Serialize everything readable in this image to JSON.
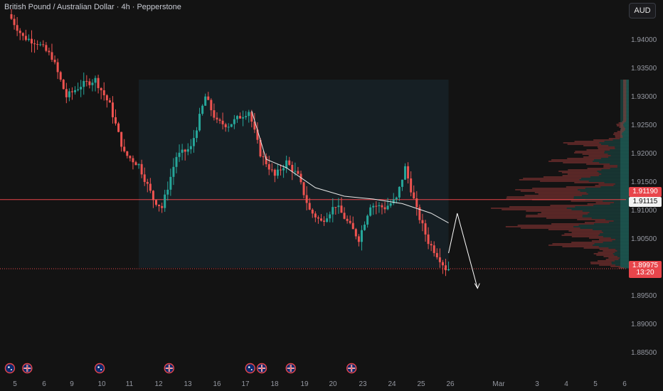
{
  "header": {
    "title": "British Pound / Australian Dollar · 4h · Pepperstone",
    "currency_button": "AUD"
  },
  "colors": {
    "background": "#131313",
    "up": "#26a69a",
    "down": "#ef5350",
    "ma": "#e8e8e8",
    "range_box": "#1a2a33",
    "current_line": "#e8454b",
    "axis_text": "#9598a1"
  },
  "price_tags": {
    "high_line": "1.91190",
    "vwap": "1.91115",
    "last_price": "1.89975",
    "countdown": "13:20"
  },
  "chart_data": {
    "type": "candlestick",
    "title": "British Pound / Australian Dollar · 4h · Pepperstone",
    "ylim": [
      1.882,
      1.947
    ],
    "y_ticks": [
      "1.94000",
      "1.93500",
      "1.93000",
      "1.92500",
      "1.92000",
      "1.91500",
      "1.91000",
      "1.90500",
      "1.90000",
      "1.89500",
      "1.89000",
      "1.88500"
    ],
    "y_tick_values": [
      1.94,
      1.935,
      1.93,
      1.925,
      1.92,
      1.915,
      1.91,
      1.905,
      1.9,
      1.895,
      1.89,
      1.885
    ],
    "x_ticks": [
      "5",
      "6",
      "9",
      "10",
      "11",
      "12",
      "13",
      "16",
      "17",
      "18",
      "19",
      "20",
      "23",
      "24",
      "25",
      "26",
      "Mar",
      "3",
      "4",
      "5",
      "6"
    ],
    "candle_count": 152,
    "price_path": [
      [
        0,
        1.9445
      ],
      [
        5,
        1.9405
      ],
      [
        10,
        1.9395
      ],
      [
        15,
        1.937
      ],
      [
        20,
        1.93
      ],
      [
        25,
        1.932
      ],
      [
        30,
        1.933
      ],
      [
        35,
        1.9285
      ],
      [
        40,
        1.92
      ],
      [
        45,
        1.918
      ],
      [
        50,
        1.912
      ],
      [
        53,
        1.9105
      ],
      [
        58,
        1.9195
      ],
      [
        63,
        1.921
      ],
      [
        68,
        1.93
      ],
      [
        72,
        1.9255
      ],
      [
        76,
        1.925
      ],
      [
        80,
        1.9265
      ],
      [
        83,
        1.9275
      ],
      [
        87,
        1.92
      ],
      [
        92,
        1.916
      ],
      [
        96,
        1.9185
      ],
      [
        100,
        1.916
      ],
      [
        104,
        1.91
      ],
      [
        108,
        1.908
      ],
      [
        113,
        1.911
      ],
      [
        117,
        1.908
      ],
      [
        121,
        1.905
      ],
      [
        125,
        1.911
      ],
      [
        130,
        1.9105
      ],
      [
        134,
        1.912
      ],
      [
        137,
        1.9175
      ],
      [
        141,
        1.91
      ],
      [
        145,
        1.9045
      ],
      [
        149,
        1.9015
      ],
      [
        151,
        1.8998
      ]
    ],
    "ma_series": [
      [
        83,
        1.9275
      ],
      [
        88,
        1.919
      ],
      [
        95,
        1.9175
      ],
      [
        105,
        1.914
      ],
      [
        115,
        1.9125
      ],
      [
        125,
        1.912
      ],
      [
        135,
        1.9112
      ],
      [
        145,
        1.9095
      ],
      [
        151,
        1.9078
      ]
    ],
    "projection": [
      [
        151,
        1.9025
      ],
      [
        154,
        1.9095
      ],
      [
        161,
        1.8963
      ]
    ],
    "range_box": {
      "x_start": 44,
      "x_end": 151,
      "y_top": 1.933,
      "y_bottom": 1.8999
    },
    "lines": {
      "current_price": 1.9119,
      "last_price_dotted": 1.89975
    },
    "volume_profile": {
      "y_top": 1.933,
      "y_bottom": 1.8999,
      "poc": 1.9112
    },
    "event_markers": [
      {
        "x": -1,
        "kind": "flag-au"
      },
      {
        "x": 5,
        "kind": "flag-uk"
      },
      {
        "x": 30,
        "kind": "flag-au"
      },
      {
        "x": 54,
        "kind": "flag-uk"
      },
      {
        "x": 82,
        "kind": "flag-au"
      },
      {
        "x": 86,
        "kind": "flag-uk"
      },
      {
        "x": 96,
        "kind": "flag-uk"
      },
      {
        "x": 117,
        "kind": "flag-uk"
      }
    ]
  }
}
